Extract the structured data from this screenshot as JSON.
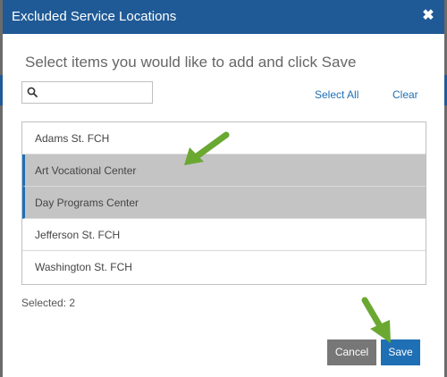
{
  "dialog": {
    "title": "Excluded Service Locations",
    "close_glyph": "✖",
    "instruction": "Select items you would like to add and click Save"
  },
  "search": {
    "placeholder": "",
    "value": ""
  },
  "links": {
    "select_all": "Select All",
    "clear": "Clear"
  },
  "items": [
    {
      "label": "Adams St. FCH",
      "selected": false
    },
    {
      "label": "Art Vocational Center",
      "selected": true
    },
    {
      "label": "Day Programs Center",
      "selected": true
    },
    {
      "label": "Jefferson St. FCH",
      "selected": false
    },
    {
      "label": "Washington St. FCH",
      "selected": false
    }
  ],
  "selected_count_text": "Selected: 2",
  "buttons": {
    "cancel": "Cancel",
    "save": "Save"
  },
  "colors": {
    "header": "#1f5a96",
    "accent": "#1f6fb5",
    "selected_row": "#c4c4c4",
    "annotation_arrow": "#6aa832"
  },
  "icons": {
    "search": "search-icon",
    "close": "close-icon",
    "arrow": "arrow-annotation-icon"
  }
}
